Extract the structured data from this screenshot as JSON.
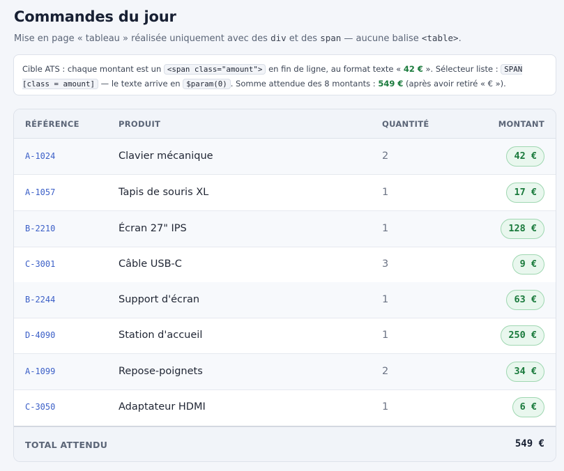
{
  "header": {
    "title": "Commandes du jour",
    "subtitle_a": "Mise en page « tableau » réalisée uniquement avec des ",
    "subtitle_div": "div",
    "subtitle_b": " et des ",
    "subtitle_span": "span",
    "subtitle_c": " — aucune balise ",
    "subtitle_table": "<table>",
    "subtitle_d": "."
  },
  "note": {
    "t1": "Cible ATS : chaque montant est un ",
    "c1": "<span class=\"amount\">",
    "t2": " en fin de ligne, au format texte « ",
    "s1": "42 €",
    "t3": " ». Sélecteur liste : ",
    "c2": "SPAN [class = amount]",
    "t4": " — le texte arrive en ",
    "c3": "$param(0)",
    "t5": ". Somme attendue des 8 montants : ",
    "s2": "549 €",
    "t6": " (après avoir retiré « € »)."
  },
  "table": {
    "headers": {
      "ref": "RÉFÉRENCE",
      "product": "PRODUIT",
      "qty": "QUANTITÉ",
      "amount": "MONTANT"
    },
    "rows": [
      {
        "ref": "A-1024",
        "product": "Clavier mécanique",
        "qty": "2",
        "amount": "42 €"
      },
      {
        "ref": "A-1057",
        "product": "Tapis de souris XL",
        "qty": "1",
        "amount": "17 €"
      },
      {
        "ref": "B-2210",
        "product": "Écran 27\" IPS",
        "qty": "1",
        "amount": "128 €"
      },
      {
        "ref": "C-3001",
        "product": "Câble USB-C",
        "qty": "3",
        "amount": "9 €"
      },
      {
        "ref": "B-2244",
        "product": "Support d'écran",
        "qty": "1",
        "amount": "63 €"
      },
      {
        "ref": "D-4090",
        "product": "Station d'accueil",
        "qty": "1",
        "amount": "250 €"
      },
      {
        "ref": "A-1099",
        "product": "Repose-poignets",
        "qty": "2",
        "amount": "34 €"
      },
      {
        "ref": "C-3050",
        "product": "Adaptateur HDMI",
        "qty": "1",
        "amount": "6 €"
      }
    ],
    "footer": {
      "label": "TOTAL ATTENDU",
      "total": "549 €"
    }
  },
  "colors": {
    "amount_text": "#1a7a3c",
    "amount_bg": "#e9f7ee",
    "ref_link": "#3b5fc7"
  }
}
